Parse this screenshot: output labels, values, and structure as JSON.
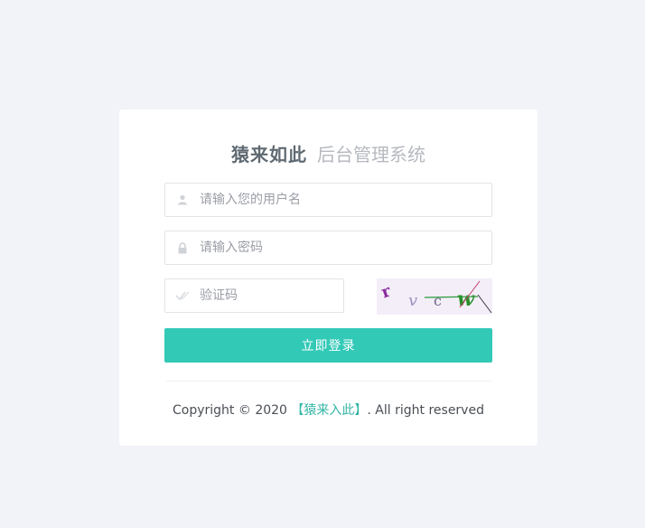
{
  "header": {
    "brand": "猿来如此",
    "subtitle": "后台管理系统"
  },
  "form": {
    "username_placeholder": "请输入您的用户名",
    "password_placeholder": "请输入密码",
    "captcha_placeholder": "验证码",
    "captcha_code": "rvcw",
    "login_label": "立即登录",
    "username_icon": "user-icon",
    "password_icon": "lock-icon",
    "captcha_icon": "check-icon"
  },
  "footer": {
    "prefix": "Copyright © 2020 ",
    "site": "【猿来入此】",
    "suffix": ". All right reserved"
  },
  "colors": {
    "background": "#f2f3f8",
    "accent": "#33c9b7",
    "link": "#33b5a5",
    "brand_text": "#5f6a72",
    "subtitle_text": "#b6b9bf"
  }
}
